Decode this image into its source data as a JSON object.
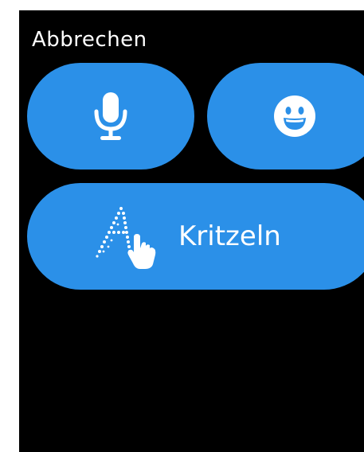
{
  "header": {
    "cancel_label": "Abbrechen"
  },
  "actions": {
    "dictation_icon": "microphone-icon",
    "emoji_icon": "smiley-face-icon",
    "scribble_icon": "scribble-letter-a-hand-icon",
    "scribble_label": "Kritzeln"
  },
  "colors": {
    "background": "#000000",
    "accent": "#2B90E8",
    "text": "#FFFFFF"
  }
}
